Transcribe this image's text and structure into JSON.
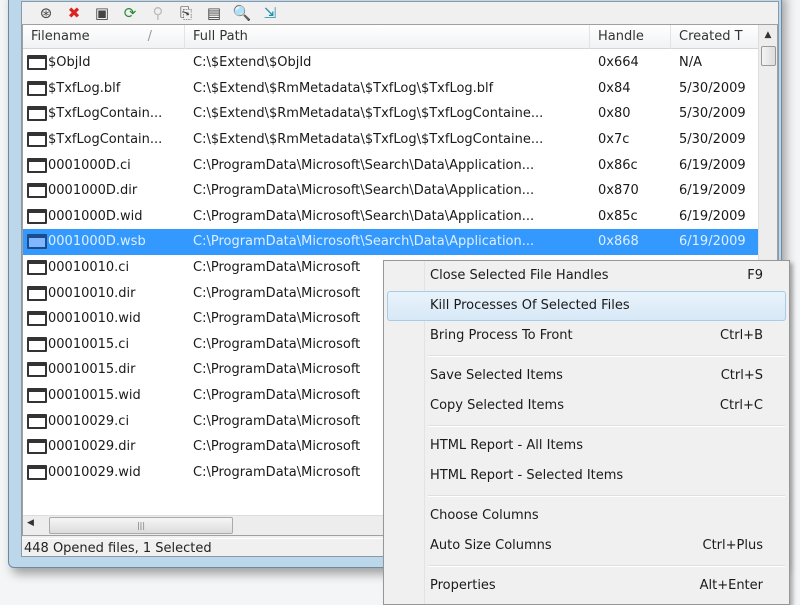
{
  "toolbar": {
    "icons": [
      "properties-icon",
      "close-handles-icon",
      "save-icon",
      "refresh-icon",
      "filter-icon",
      "copy-icon",
      "html-report-icon",
      "find-icon",
      "exit-icon"
    ]
  },
  "columns": [
    "Filename",
    "Full Path",
    "Handle",
    "Created T"
  ],
  "rows": [
    {
      "filename": "$ObjId",
      "path": "C:\\$Extend\\$ObjId",
      "handle": "0x664",
      "created": "N/A"
    },
    {
      "filename": "$TxfLog.blf",
      "path": "C:\\$Extend\\$RmMetadata\\$TxfLog\\$TxfLog.blf",
      "handle": "0x84",
      "created": "5/30/2009"
    },
    {
      "filename": "$TxfLogContain...",
      "path": "C:\\$Extend\\$RmMetadata\\$TxfLog\\$TxfLogContaine...",
      "handle": "0x80",
      "created": "5/30/2009"
    },
    {
      "filename": "$TxfLogContain...",
      "path": "C:\\$Extend\\$RmMetadata\\$TxfLog\\$TxfLogContaine...",
      "handle": "0x7c",
      "created": "5/30/2009"
    },
    {
      "filename": "0001000D.ci",
      "path": "C:\\ProgramData\\Microsoft\\Search\\Data\\Application...",
      "handle": "0x86c",
      "created": "6/19/2009"
    },
    {
      "filename": "0001000D.dir",
      "path": "C:\\ProgramData\\Microsoft\\Search\\Data\\Application...",
      "handle": "0x870",
      "created": "6/19/2009"
    },
    {
      "filename": "0001000D.wid",
      "path": "C:\\ProgramData\\Microsoft\\Search\\Data\\Application...",
      "handle": "0x85c",
      "created": "6/19/2009"
    },
    {
      "filename": "0001000D.wsb",
      "path": "C:\\ProgramData\\Microsoft\\Search\\Data\\Application...",
      "handle": "0x868",
      "created": "6/19/2009",
      "selected": true
    },
    {
      "filename": "00010010.ci",
      "path": "C:\\ProgramData\\Microsoft",
      "handle": "",
      "created": ""
    },
    {
      "filename": "00010010.dir",
      "path": "C:\\ProgramData\\Microsoft",
      "handle": "",
      "created": ""
    },
    {
      "filename": "00010010.wid",
      "path": "C:\\ProgramData\\Microsoft",
      "handle": "",
      "created": ""
    },
    {
      "filename": "00010015.ci",
      "path": "C:\\ProgramData\\Microsoft",
      "handle": "",
      "created": ""
    },
    {
      "filename": "00010015.dir",
      "path": "C:\\ProgramData\\Microsoft",
      "handle": "",
      "created": ""
    },
    {
      "filename": "00010015.wid",
      "path": "C:\\ProgramData\\Microsoft",
      "handle": "",
      "created": ""
    },
    {
      "filename": "00010029.ci",
      "path": "C:\\ProgramData\\Microsoft",
      "handle": "",
      "created": ""
    },
    {
      "filename": "00010029.dir",
      "path": "C:\\ProgramData\\Microsoft",
      "handle": "",
      "created": ""
    },
    {
      "filename": "00010029.wid",
      "path": "C:\\ProgramData\\Microsoft",
      "handle": "",
      "created": ""
    }
  ],
  "status": "448 Opened files, 1 Selected",
  "context_menu": [
    {
      "label": "Close Selected File Handles",
      "shortcut": "F9"
    },
    {
      "label": "Kill Processes Of Selected Files",
      "shortcut": "",
      "highlighted": true
    },
    {
      "label": "Bring Process To Front",
      "shortcut": "Ctrl+B"
    },
    {
      "sep": true
    },
    {
      "label": "Save Selected Items",
      "shortcut": "Ctrl+S"
    },
    {
      "label": "Copy Selected Items",
      "shortcut": "Ctrl+C"
    },
    {
      "sep": true
    },
    {
      "label": "HTML Report - All Items",
      "shortcut": ""
    },
    {
      "label": "HTML Report - Selected Items",
      "shortcut": ""
    },
    {
      "sep": true
    },
    {
      "label": "Choose Columns",
      "shortcut": ""
    },
    {
      "label": "Auto Size Columns",
      "shortcut": "Ctrl+Plus"
    },
    {
      "sep": true
    },
    {
      "label": "Properties",
      "shortcut": "Alt+Enter"
    }
  ],
  "colors": {
    "selection": "#3399ff",
    "menu_highlight": "#d7e8f6"
  }
}
